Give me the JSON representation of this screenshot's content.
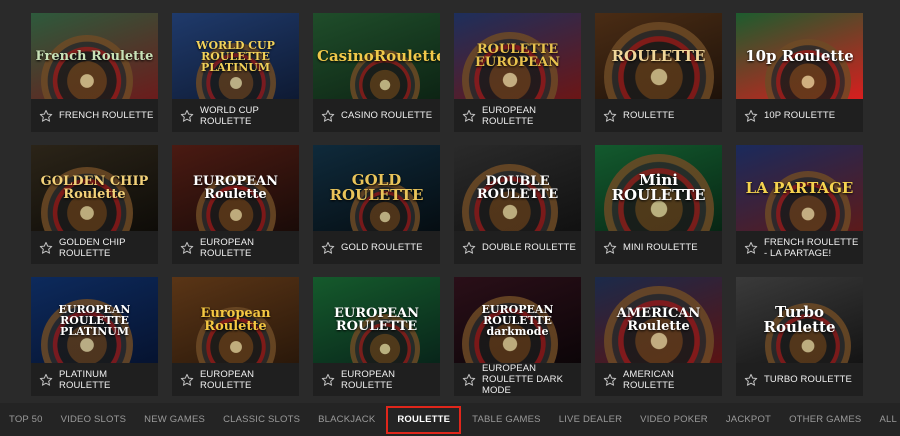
{
  "games": [
    {
      "label": "FRENCH ROULETTE",
      "art": "French Roulette",
      "bg": "#2d5a3c",
      "bg2": "#6b1c1c",
      "art_color": "#c9e2b8",
      "icon": "roulette-wheel-icon"
    },
    {
      "label": "WORLD CUP ROULETTE",
      "art": "WORLD CUP ROULETTE PLATINUM",
      "bg": "#1f3a6b",
      "bg2": "#0e1a33",
      "art_color": "#f2d25a",
      "icon": "trophy-wheel-icon"
    },
    {
      "label": "CASINO ROULETTE",
      "art": "CasinoRoulette",
      "bg": "#1f4d2a",
      "bg2": "#0d2414",
      "art_color": "#f0c94a",
      "icon": "trophy-icon"
    },
    {
      "label": "EUROPEAN ROULETTE",
      "art": "ROULETTE EUROPEAN",
      "bg": "#1d2f5c",
      "bg2": "#6b1616",
      "art_color": "#e8c24e",
      "icon": "roulette-wheel-icon"
    },
    {
      "label": "ROULETTE",
      "art": "ROULETTE",
      "bg": "#4a2c14",
      "bg2": "#1e120a",
      "art_color": "#f1d79a",
      "icon": "roulette-wheel-icon"
    },
    {
      "label": "10P ROULETTE",
      "art": "10p Roulette",
      "bg": "#1c5c2e",
      "bg2": "#d81e1e",
      "art_color": "#ffffff",
      "icon": "roulette-wheel-icon"
    },
    {
      "label": "GOLDEN CHIP ROULETTE",
      "art": "GOLDEN CHIP Roulette",
      "bg": "#2b2418",
      "bg2": "#0e0c08",
      "art_color": "#f3d27a",
      "icon": "chip-icon"
    },
    {
      "label": "EUROPEAN ROULETTE",
      "art": "EUROPEAN Roulette",
      "bg": "#4a1a12",
      "bg2": "#1a0b08",
      "art_color": "#ffffff",
      "icon": "roulette-wheel-icon"
    },
    {
      "label": "GOLD ROULETTE",
      "art": "GOLD ROULETTE",
      "bg": "#0f2a3b",
      "bg2": "#050d12",
      "art_color": "#e9c45a",
      "icon": "roulette-wheel-icon"
    },
    {
      "label": "DOUBLE ROULETTE",
      "art": "DOUBLE ROULETTE",
      "bg": "#2a2a2a",
      "bg2": "#111111",
      "art_color": "#ffffff",
      "icon": "star-logo-icon"
    },
    {
      "label": "MINI ROULETTE",
      "art": "Mini ROULETTE",
      "bg": "#135a2e",
      "bg2": "#072614",
      "art_color": "#ffffff",
      "icon": "roulette-wheel-icon"
    },
    {
      "label": "FRENCH ROULETTE - LA PARTAGE!",
      "art": "LA PARTAGE",
      "bg": "#1a2a5c",
      "bg2": "#5c1a1a",
      "art_color": "#f5d34f",
      "icon": "dealer-icon"
    },
    {
      "label": "PLATINUM ROULETTE",
      "art": "EUROPEAN ROULETTE PLATINUM",
      "bg": "#0d2a5c",
      "bg2": "#061330",
      "art_color": "#ffffff",
      "icon": "roulette-wheel-icon"
    },
    {
      "label": "EUROPEAN ROULETTE",
      "art": "European Roulette",
      "bg": "#5a3516",
      "bg2": "#2a180a",
      "art_color": "#f5c842",
      "icon": "roulette-wheel-icon"
    },
    {
      "label": "EUROPEAN ROULETTE",
      "art": "EUROPEAN ROULETTE",
      "bg": "#155a2c",
      "bg2": "#08251a",
      "art_color": "#ffffff",
      "icon": "roulette-wheel-icon"
    },
    {
      "label": "EUROPEAN ROULETTE DARK MODE",
      "art": "EUROPEAN ROULETTE darkmode",
      "bg": "#2a0f18",
      "bg2": "#0c0508",
      "art_color": "#ffffff",
      "icon": "roulette-wheel-icon"
    },
    {
      "label": "AMERICAN ROULETTE",
      "art": "AMERICAN Roulette",
      "bg": "#1b2a4a",
      "bg2": "#5a1313",
      "art_color": "#ffffff",
      "icon": "roulette-wheel-icon"
    },
    {
      "label": "TURBO ROULETTE",
      "art": "Turbo Roulette",
      "bg": "#3a3a3a",
      "bg2": "#141414",
      "art_color": "#ffffff",
      "icon": "roulette-wheel-icon"
    }
  ],
  "nav": [
    {
      "label": "TOP 50",
      "active": false
    },
    {
      "label": "VIDEO SLOTS",
      "active": false
    },
    {
      "label": "NEW GAMES",
      "active": false
    },
    {
      "label": "CLASSIC SLOTS",
      "active": false
    },
    {
      "label": "BLACKJACK",
      "active": false
    },
    {
      "label": "ROULETTE",
      "active": true
    },
    {
      "label": "TABLE GAMES",
      "active": false
    },
    {
      "label": "LIVE DEALER",
      "active": false
    },
    {
      "label": "VIDEO POKER",
      "active": false
    },
    {
      "label": "JACKPOT",
      "active": false
    },
    {
      "label": "OTHER GAMES",
      "active": false
    },
    {
      "label": "ALL GAMES",
      "active": false
    }
  ],
  "colors": {
    "background": "#2a2a2a",
    "card_info_bg": "#1f1f1f",
    "nav_bg": "#242424",
    "nav_text": "#9a9a9a",
    "active_border": "#e0261b",
    "star_outline": "#bdbdbd"
  }
}
